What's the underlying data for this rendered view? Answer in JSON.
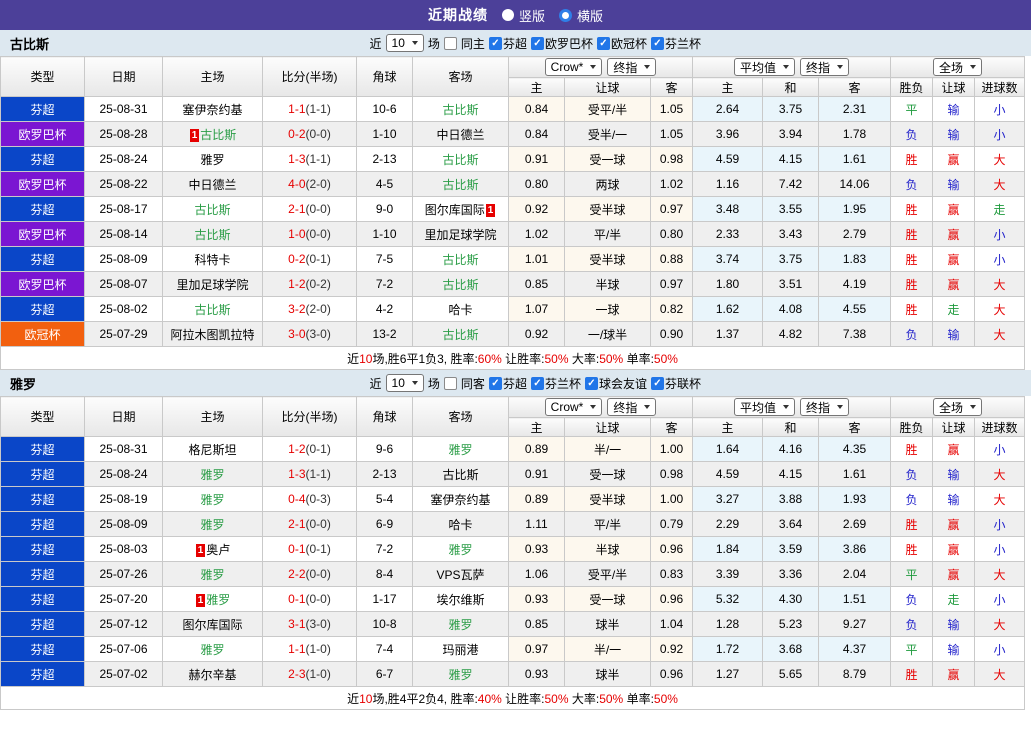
{
  "topbar": {
    "title": "近期战绩",
    "options": [
      {
        "label": "竖版",
        "checked": false
      },
      {
        "label": "横版",
        "checked": true
      }
    ]
  },
  "filter_labels": {
    "near": "近",
    "count": "10",
    "games": "场"
  },
  "header": {
    "left_cols": [
      "类型",
      "日期",
      "主场",
      "比分(半场)",
      "角球",
      "客场"
    ],
    "odds_selects": [
      "Crow*",
      "终指"
    ],
    "odds_cols": [
      "主",
      "让球",
      "客"
    ],
    "avg_selects": [
      "平均值",
      "终指"
    ],
    "avg_cols": [
      "主",
      "和",
      "客"
    ],
    "result_select": "全场",
    "result_cols": [
      "胜负",
      "让球",
      "进球数"
    ]
  },
  "colors": {
    "topbar_bg": "#4c4099",
    "filter_bg": "#dde8f0",
    "league": {
      "芬超": "#0a46c8",
      "欧罗巴杯": "#7b16d2",
      "欧冠杯": "#f2600f"
    },
    "team_green": "#2a9d46",
    "score_red": "#e60000",
    "card_bg": "#e60000",
    "result": {
      "胜": "#e60000",
      "赢": "#e60000",
      "大": "#e60000",
      "负": "#2323cc",
      "输": "#2323cc",
      "小": "#2323cc",
      "平": "#1f9a3d",
      "走": "#1f9a3d"
    },
    "odds_bg": "#fdf8ee",
    "avg_bg": "#e9f5fb",
    "row_alt_bg": "#efefef",
    "summary_red": "#e60000",
    "checkbox_blue": "#2176e8"
  },
  "sections": [
    {
      "team": "古比斯",
      "same_label": "同主",
      "leagues": [
        "芬超",
        "欧罗巴杯",
        "欧冠杯",
        "芬兰杯"
      ],
      "rows": [
        {
          "league": "芬超",
          "date": "25-08-31",
          "home": "塞伊奈约基",
          "home_card": "",
          "home_card_pos": "",
          "away": "古比斯",
          "away_card": "",
          "away_card_pos": "",
          "ft": "1-1",
          "ht": "(1-1)",
          "corner": "10-6",
          "odds": [
            "0.84",
            "受平/半",
            "1.05"
          ],
          "avg": [
            "2.64",
            "3.75",
            "2.31"
          ],
          "res": [
            "平",
            "输",
            "小"
          ]
        },
        {
          "league": "欧罗巴杯",
          "date": "25-08-28",
          "home": "古比斯",
          "home_card": "1",
          "home_card_pos": "before",
          "away": "中日德兰",
          "away_card": "",
          "away_card_pos": "",
          "ft": "0-2",
          "ht": "(0-0)",
          "corner": "1-10",
          "odds": [
            "0.84",
            "受半/一",
            "1.05"
          ],
          "avg": [
            "3.96",
            "3.94",
            "1.78"
          ],
          "res": [
            "负",
            "输",
            "小"
          ]
        },
        {
          "league": "芬超",
          "date": "25-08-24",
          "home": "雅罗",
          "home_card": "",
          "home_card_pos": "",
          "away": "古比斯",
          "away_card": "",
          "away_card_pos": "",
          "ft": "1-3",
          "ht": "(1-1)",
          "corner": "2-13",
          "odds": [
            "0.91",
            "受一球",
            "0.98"
          ],
          "avg": [
            "4.59",
            "4.15",
            "1.61"
          ],
          "res": [
            "胜",
            "赢",
            "大"
          ]
        },
        {
          "league": "欧罗巴杯",
          "date": "25-08-22",
          "home": "中日德兰",
          "home_card": "",
          "home_card_pos": "",
          "away": "古比斯",
          "away_card": "",
          "away_card_pos": "",
          "ft": "4-0",
          "ht": "(2-0)",
          "corner": "4-5",
          "odds": [
            "0.80",
            "两球",
            "1.02"
          ],
          "avg": [
            "1.16",
            "7.42",
            "14.06"
          ],
          "res": [
            "负",
            "输",
            "大"
          ]
        },
        {
          "league": "芬超",
          "date": "25-08-17",
          "home": "古比斯",
          "home_card": "",
          "home_card_pos": "",
          "away": "图尔库国际",
          "away_card": "1",
          "away_card_pos": "after",
          "ft": "2-1",
          "ht": "(0-0)",
          "corner": "9-0",
          "odds": [
            "0.92",
            "受半球",
            "0.97"
          ],
          "avg": [
            "3.48",
            "3.55",
            "1.95"
          ],
          "res": [
            "胜",
            "赢",
            "走"
          ]
        },
        {
          "league": "欧罗巴杯",
          "date": "25-08-14",
          "home": "古比斯",
          "home_card": "",
          "home_card_pos": "",
          "away": "里加足球学院",
          "away_card": "",
          "away_card_pos": "",
          "ft": "1-0",
          "ht": "(0-0)",
          "corner": "1-10",
          "odds": [
            "1.02",
            "平/半",
            "0.80"
          ],
          "avg": [
            "2.33",
            "3.43",
            "2.79"
          ],
          "res": [
            "胜",
            "赢",
            "小"
          ]
        },
        {
          "league": "芬超",
          "date": "25-08-09",
          "home": "科特卡",
          "home_card": "",
          "home_card_pos": "",
          "away": "古比斯",
          "away_card": "",
          "away_card_pos": "",
          "ft": "0-2",
          "ht": "(0-1)",
          "corner": "7-5",
          "odds": [
            "1.01",
            "受半球",
            "0.88"
          ],
          "avg": [
            "3.74",
            "3.75",
            "1.83"
          ],
          "res": [
            "胜",
            "赢",
            "小"
          ]
        },
        {
          "league": "欧罗巴杯",
          "date": "25-08-07",
          "home": "里加足球学院",
          "home_card": "",
          "home_card_pos": "",
          "away": "古比斯",
          "away_card": "",
          "away_card_pos": "",
          "ft": "1-2",
          "ht": "(0-2)",
          "corner": "7-2",
          "odds": [
            "0.85",
            "半球",
            "0.97"
          ],
          "avg": [
            "1.80",
            "3.51",
            "4.19"
          ],
          "res": [
            "胜",
            "赢",
            "大"
          ]
        },
        {
          "league": "芬超",
          "date": "25-08-02",
          "home": "古比斯",
          "home_card": "",
          "home_card_pos": "",
          "away": "哈卡",
          "away_card": "",
          "away_card_pos": "",
          "ft": "3-2",
          "ht": "(2-0)",
          "corner": "4-2",
          "odds": [
            "1.07",
            "一球",
            "0.82"
          ],
          "avg": [
            "1.62",
            "4.08",
            "4.55"
          ],
          "res": [
            "胜",
            "走",
            "大"
          ]
        },
        {
          "league": "欧冠杯",
          "date": "25-07-29",
          "home": "阿拉木图凯拉特",
          "home_card": "",
          "home_card_pos": "",
          "away": "古比斯",
          "away_card": "",
          "away_card_pos": "",
          "ft": "3-0",
          "ht": "(3-0)",
          "corner": "13-2",
          "odds": [
            "0.92",
            "一/球半",
            "0.90"
          ],
          "avg": [
            "1.37",
            "4.82",
            "7.38"
          ],
          "res": [
            "负",
            "输",
            "大"
          ]
        }
      ],
      "summary": [
        {
          "t": "近",
          "red": false
        },
        {
          "t": "10",
          "red": true
        },
        {
          "t": "场,胜6平1负3, 胜率:",
          "red": false
        },
        {
          "t": "60%",
          "red": true
        },
        {
          "t": " 让胜率:",
          "red": false
        },
        {
          "t": "50%",
          "red": true
        },
        {
          "t": " 大率:",
          "red": false
        },
        {
          "t": "50%",
          "red": true
        },
        {
          "t": " 单率:",
          "red": false
        },
        {
          "t": "50%",
          "red": true
        }
      ]
    },
    {
      "team": "雅罗",
      "same_label": "同客",
      "leagues": [
        "芬超",
        "芬兰杯",
        "球会友谊",
        "芬联杯"
      ],
      "rows": [
        {
          "league": "芬超",
          "date": "25-08-31",
          "home": "格尼斯坦",
          "home_card": "",
          "home_card_pos": "",
          "away": "雅罗",
          "away_card": "",
          "away_card_pos": "",
          "ft": "1-2",
          "ht": "(0-1)",
          "corner": "9-6",
          "odds": [
            "0.89",
            "半/一",
            "1.00"
          ],
          "avg": [
            "1.64",
            "4.16",
            "4.35"
          ],
          "res": [
            "胜",
            "赢",
            "小"
          ]
        },
        {
          "league": "芬超",
          "date": "25-08-24",
          "home": "雅罗",
          "home_card": "",
          "home_card_pos": "",
          "away": "古比斯",
          "away_card": "",
          "away_card_pos": "",
          "ft": "1-3",
          "ht": "(1-1)",
          "corner": "2-13",
          "odds": [
            "0.91",
            "受一球",
            "0.98"
          ],
          "avg": [
            "4.59",
            "4.15",
            "1.61"
          ],
          "res": [
            "负",
            "输",
            "大"
          ]
        },
        {
          "league": "芬超",
          "date": "25-08-19",
          "home": "雅罗",
          "home_card": "",
          "home_card_pos": "",
          "away": "塞伊奈约基",
          "away_card": "",
          "away_card_pos": "",
          "ft": "0-4",
          "ht": "(0-3)",
          "corner": "5-4",
          "odds": [
            "0.89",
            "受半球",
            "1.00"
          ],
          "avg": [
            "3.27",
            "3.88",
            "1.93"
          ],
          "res": [
            "负",
            "输",
            "大"
          ]
        },
        {
          "league": "芬超",
          "date": "25-08-09",
          "home": "雅罗",
          "home_card": "",
          "home_card_pos": "",
          "away": "哈卡",
          "away_card": "",
          "away_card_pos": "",
          "ft": "2-1",
          "ht": "(0-0)",
          "corner": "6-9",
          "odds": [
            "1.11",
            "平/半",
            "0.79"
          ],
          "avg": [
            "2.29",
            "3.64",
            "2.69"
          ],
          "res": [
            "胜",
            "赢",
            "小"
          ]
        },
        {
          "league": "芬超",
          "date": "25-08-03",
          "home": "奥卢",
          "home_card": "1",
          "home_card_pos": "before",
          "away": "雅罗",
          "away_card": "",
          "away_card_pos": "",
          "ft": "0-1",
          "ht": "(0-1)",
          "corner": "7-2",
          "odds": [
            "0.93",
            "半球",
            "0.96"
          ],
          "avg": [
            "1.84",
            "3.59",
            "3.86"
          ],
          "res": [
            "胜",
            "赢",
            "小"
          ]
        },
        {
          "league": "芬超",
          "date": "25-07-26",
          "home": "雅罗",
          "home_card": "",
          "home_card_pos": "",
          "away": "VPS瓦萨",
          "away_card": "",
          "away_card_pos": "",
          "ft": "2-2",
          "ht": "(0-0)",
          "corner": "8-4",
          "odds": [
            "1.06",
            "受平/半",
            "0.83"
          ],
          "avg": [
            "3.39",
            "3.36",
            "2.04"
          ],
          "res": [
            "平",
            "赢",
            "大"
          ]
        },
        {
          "league": "芬超",
          "date": "25-07-20",
          "home": "雅罗",
          "home_card": "1",
          "home_card_pos": "before",
          "away": "埃尔维斯",
          "away_card": "",
          "away_card_pos": "",
          "ft": "0-1",
          "ht": "(0-0)",
          "corner": "1-17",
          "odds": [
            "0.93",
            "受一球",
            "0.96"
          ],
          "avg": [
            "5.32",
            "4.30",
            "1.51"
          ],
          "res": [
            "负",
            "走",
            "小"
          ]
        },
        {
          "league": "芬超",
          "date": "25-07-12",
          "home": "图尔库国际",
          "home_card": "",
          "home_card_pos": "",
          "away": "雅罗",
          "away_card": "",
          "away_card_pos": "",
          "ft": "3-1",
          "ht": "(3-0)",
          "corner": "10-8",
          "odds": [
            "0.85",
            "球半",
            "1.04"
          ],
          "avg": [
            "1.28",
            "5.23",
            "9.27"
          ],
          "res": [
            "负",
            "输",
            "大"
          ]
        },
        {
          "league": "芬超",
          "date": "25-07-06",
          "home": "雅罗",
          "home_card": "",
          "home_card_pos": "",
          "away": "玛丽港",
          "away_card": "",
          "away_card_pos": "",
          "ft": "1-1",
          "ht": "(1-0)",
          "corner": "7-4",
          "odds": [
            "0.97",
            "半/一",
            "0.92"
          ],
          "avg": [
            "1.72",
            "3.68",
            "4.37"
          ],
          "res": [
            "平",
            "输",
            "小"
          ]
        },
        {
          "league": "芬超",
          "date": "25-07-02",
          "home": "赫尔辛基",
          "home_card": "",
          "home_card_pos": "",
          "away": "雅罗",
          "away_card": "",
          "away_card_pos": "",
          "ft": "2-3",
          "ht": "(1-0)",
          "corner": "6-7",
          "odds": [
            "0.93",
            "球半",
            "0.96"
          ],
          "avg": [
            "1.27",
            "5.65",
            "8.79"
          ],
          "res": [
            "胜",
            "赢",
            "大"
          ]
        }
      ],
      "summary": [
        {
          "t": "近",
          "red": false
        },
        {
          "t": "10",
          "red": true
        },
        {
          "t": "场,胜4平2负4, 胜率:",
          "red": false
        },
        {
          "t": "40%",
          "red": true
        },
        {
          "t": " 让胜率:",
          "red": false
        },
        {
          "t": "50%",
          "red": true
        },
        {
          "t": " 大率:",
          "red": false
        },
        {
          "t": "50%",
          "red": true
        },
        {
          "t": " 单率:",
          "red": false
        },
        {
          "t": "50%",
          "red": true
        }
      ]
    }
  ]
}
